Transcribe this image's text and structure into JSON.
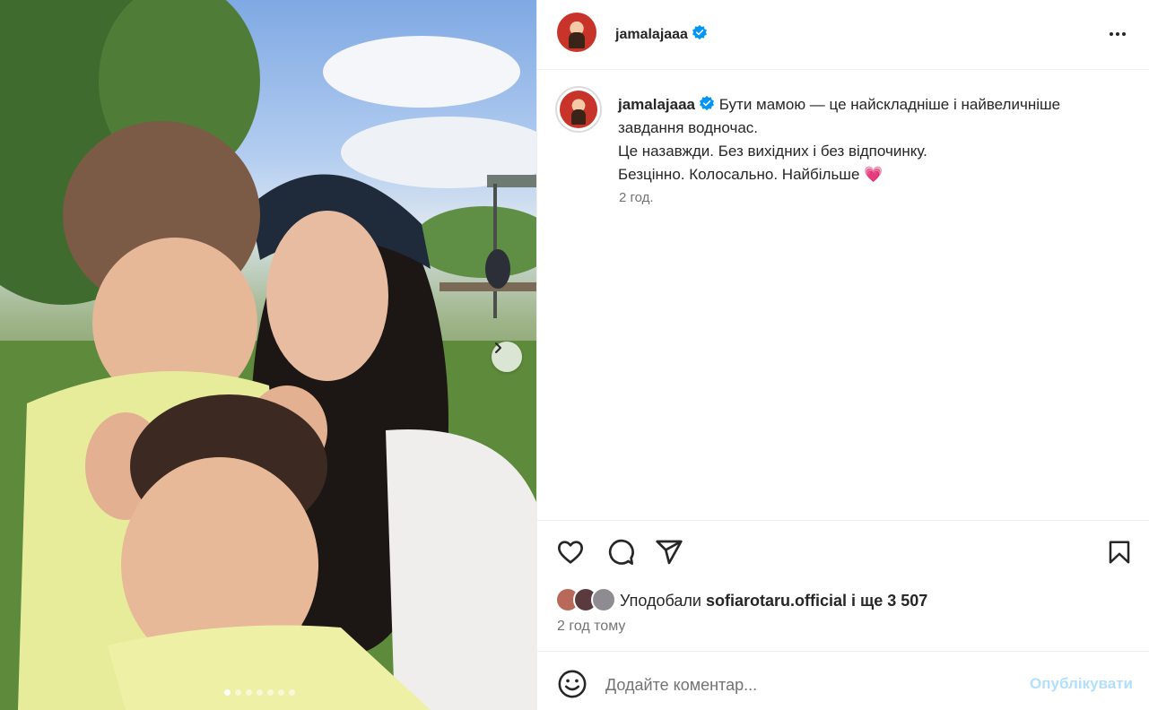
{
  "post": {
    "username": "jamalajaaa",
    "verified": true,
    "caption_lines": [
      "Бути мамою — це найскладніше і найвеличніше",
      "завдання водночас.",
      "Це назавжди. Без вихідних і без відпочинку.",
      "Безцінно. Колосально. Найбільше"
    ],
    "caption_emoji": "💗",
    "caption_time": "2 год.",
    "photo_index": 1,
    "photo_count": 7
  },
  "likes": {
    "prefix": "Уподобали",
    "user": "sofiarotaru.official",
    "suffix": "і ще 3 507"
  },
  "post_time": "2 год тому",
  "comment": {
    "placeholder": "Додайте коментар...",
    "publish_label": "Опублікувати"
  },
  "icons": {
    "verified": "verified-badge-icon",
    "more": "more-options-icon",
    "next": "chevron-right-icon",
    "like": "heart-icon",
    "comment": "comment-icon",
    "share": "share-icon",
    "save": "bookmark-icon",
    "emoji": "emoji-icon"
  },
  "colors": {
    "accent": "#0095f6",
    "publish_disabled": "#b2dffc",
    "text": "#262626",
    "secondary": "#737373",
    "verified": "#0095f6"
  }
}
